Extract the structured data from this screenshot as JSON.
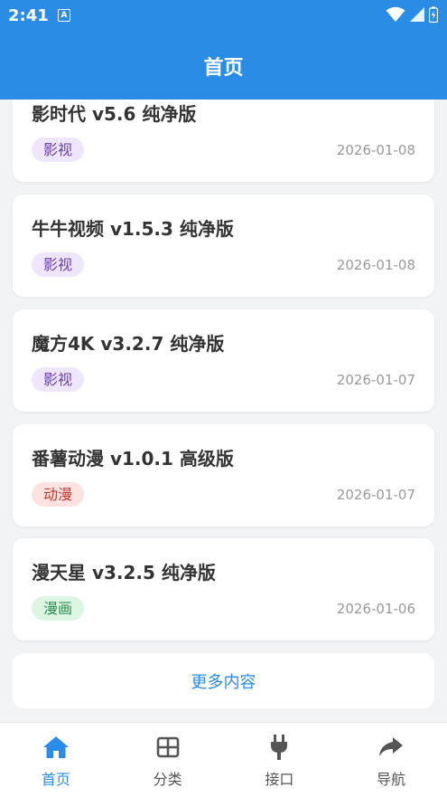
{
  "status_bar": {
    "time": "2:41",
    "notification": "A"
  },
  "header": {
    "title": "首页"
  },
  "cards": [
    {
      "title": "影时代 v5.6 纯净版",
      "tag": "影视",
      "date": "2026-01-08"
    },
    {
      "title": "牛牛视频 v1.5.3 纯净版",
      "tag": "影视",
      "date": "2026-01-08"
    },
    {
      "title": "魔方4K v3.2.7 纯净版",
      "tag": "影视",
      "date": "2026-01-07"
    },
    {
      "title": "番薯动漫 v1.0.1 高级版",
      "tag": "动漫",
      "date": "2026-01-07"
    },
    {
      "title": "漫天星 v3.2.5 纯净版",
      "tag": "漫画",
      "date": "2026-01-06"
    }
  ],
  "more": {
    "label": "更多内容"
  },
  "bottom_nav": {
    "items": [
      {
        "label": "首页",
        "icon": "home-icon"
      },
      {
        "label": "分类",
        "icon": "grid-icon"
      },
      {
        "label": "接口",
        "icon": "plug-icon"
      },
      {
        "label": "导航",
        "icon": "share-arrow-icon"
      }
    ]
  },
  "colors": {
    "primary": "#2b8ce6",
    "video_tag_bg": "#efe6fb",
    "anime_tag_bg": "#fde2e2",
    "comic_tag_bg": "#ddf5e3"
  }
}
